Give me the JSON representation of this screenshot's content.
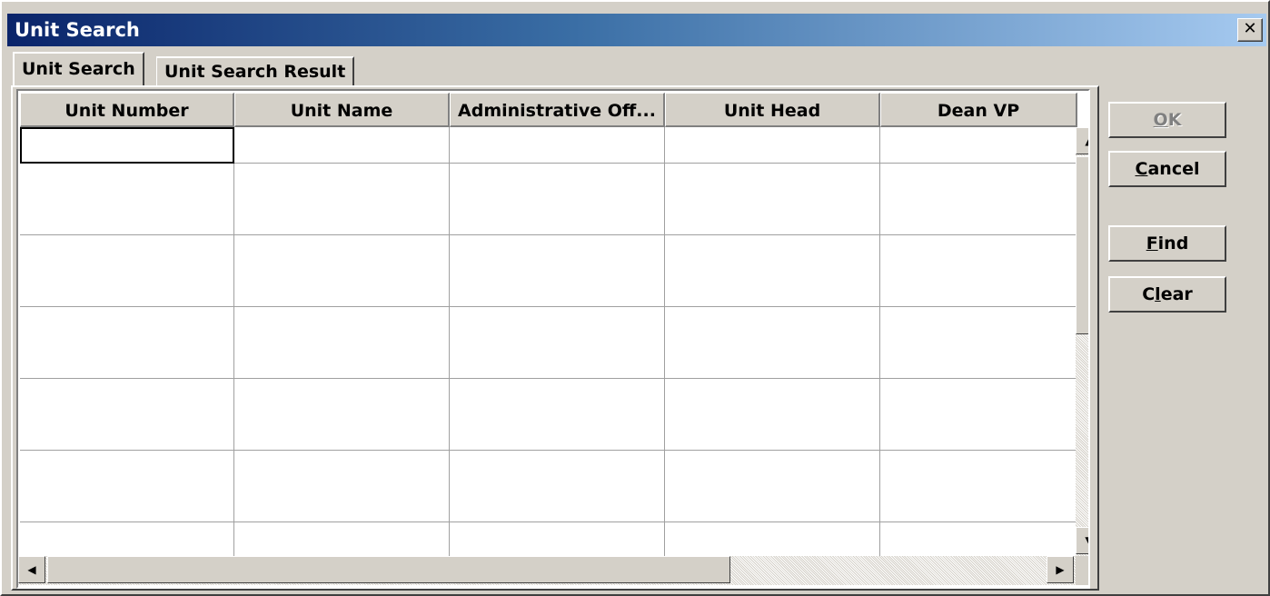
{
  "window": {
    "title": "Unit Search",
    "close_symbol": "✕"
  },
  "tabs": [
    {
      "label": "Unit Search",
      "active": true
    },
    {
      "label": "Unit Search Result",
      "active": false
    }
  ],
  "grid": {
    "columns": [
      "Unit Number",
      "Unit Name",
      "Administrative Off...",
      "Unit Head",
      "Dean VP"
    ],
    "row_count": 12
  },
  "buttons": {
    "ok": {
      "pre": "",
      "accel": "O",
      "post": "K",
      "enabled": false
    },
    "cancel": {
      "pre": "",
      "accel": "C",
      "post": "ancel",
      "enabled": true
    },
    "find": {
      "pre": "",
      "accel": "F",
      "post": "ind",
      "enabled": true
    },
    "clear": {
      "pre": "C",
      "accel": "l",
      "post": "ear",
      "enabled": true
    }
  },
  "scroll": {
    "up": "▲",
    "down": "▼",
    "left": "◀",
    "right": "▶"
  }
}
